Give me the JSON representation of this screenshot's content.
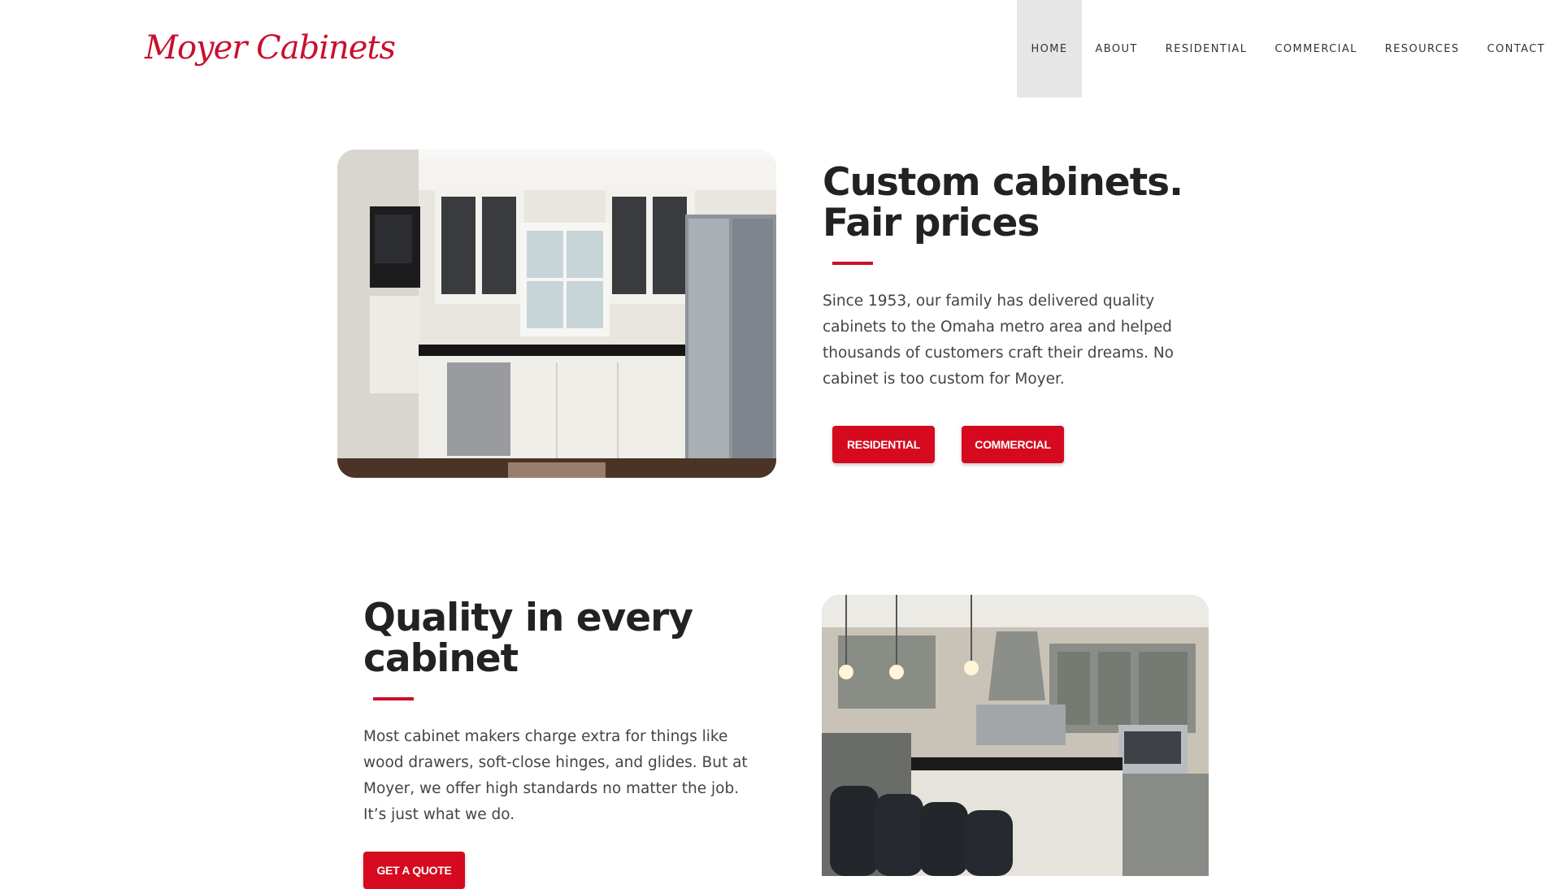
{
  "brand": {
    "logo_text": "Moyer Cabinets",
    "accent": "#c8102e",
    "button_color": "#d50a1e"
  },
  "nav": {
    "items": [
      {
        "label": "HOME",
        "active": true
      },
      {
        "label": "ABOUT"
      },
      {
        "label": "RESIDENTIAL"
      },
      {
        "label": "COMMERCIAL"
      },
      {
        "label": "RESOURCES"
      },
      {
        "label": "CONTACT"
      }
    ]
  },
  "hero": {
    "heading_line1": "Custom cabinets.",
    "heading_line2": "Fair prices",
    "body": "Since 1953, our family has delivered quality cabinets to the Omaha metro area and helped thousands of customers craft their dreams. No cabinet is too custom for Moyer.",
    "button_residential": "RESIDENTIAL",
    "button_commercial": "COMMERCIAL"
  },
  "quality": {
    "heading_line1": "Quality in every",
    "heading_line2": "cabinet",
    "body": "Most cabinet makers charge extra for things like wood drawers, soft-close hinges, and glides. But at Moyer, we offer high standards no matter the job. It’s just what we do.",
    "button_quote": "GET A QUOTE"
  }
}
